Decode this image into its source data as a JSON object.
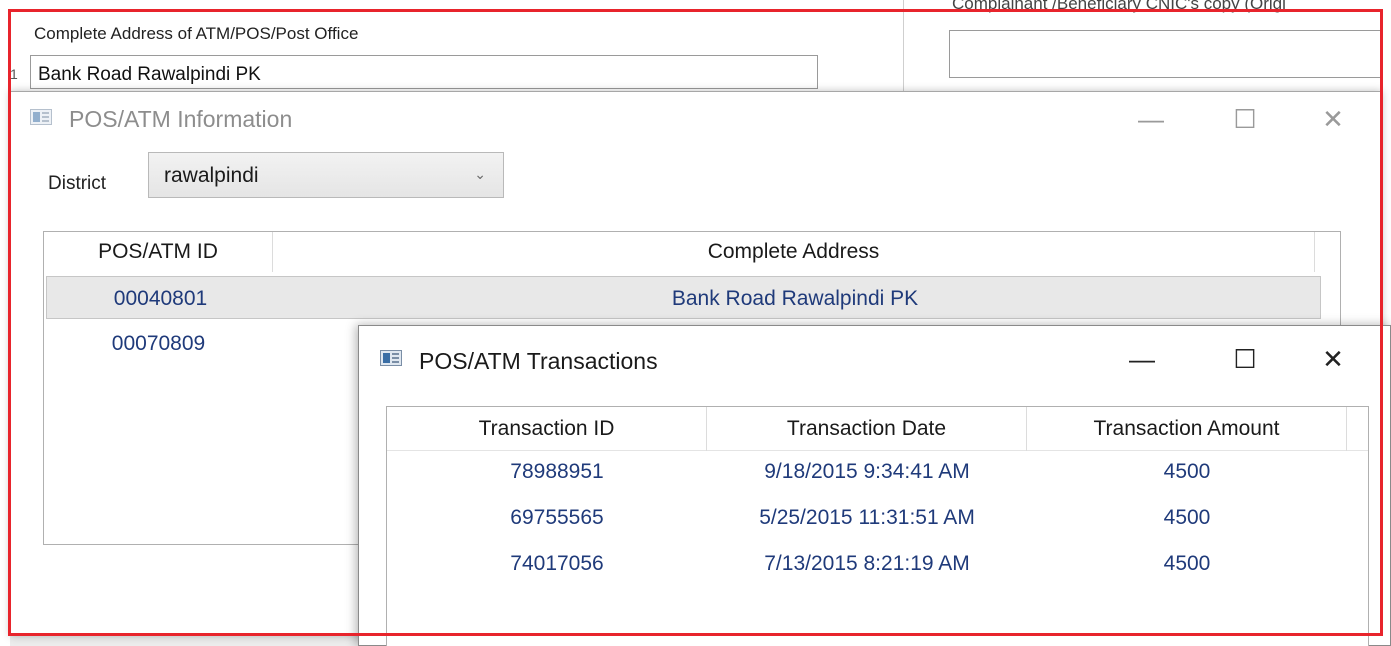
{
  "background_form": {
    "address_label": "Complete Address of ATM/POS/Post Office",
    "address_value": "Bank Road Rawalpindi PK",
    "cnic_label": "Complainant /Beneficiary CNIC's copy (Origi",
    "stray_char": "1"
  },
  "info_window": {
    "title": "POS/ATM Information",
    "controls": {
      "minimize": "—",
      "maximize": "☐",
      "close": "✕"
    },
    "district": {
      "label": "District",
      "value": "rawalpindi"
    },
    "grid": {
      "columns": [
        "POS/ATM ID",
        "Complete Address"
      ],
      "rows": [
        {
          "id": "00040801",
          "address": "Bank Road Rawalpindi PK",
          "selected": true
        },
        {
          "id": "00070809",
          "address": "",
          "selected": false
        }
      ]
    }
  },
  "transactions_window": {
    "title": "POS/ATM Transactions",
    "controls": {
      "minimize": "—",
      "maximize": "☐",
      "close": "✕"
    },
    "grid": {
      "columns": [
        "Transaction ID",
        "Transaction Date",
        "Transaction Amount"
      ],
      "rows": [
        {
          "id": "78988951",
          "date": "9/18/2015 9:34:41 AM",
          "amount": "4500"
        },
        {
          "id": "69755565",
          "date": "5/25/2015 11:31:51 AM",
          "amount": "4500"
        },
        {
          "id": "74017056",
          "date": "7/13/2015 8:21:19 AM",
          "amount": "4500"
        }
      ]
    }
  },
  "colors": {
    "highlight": "#e8242c",
    "cell_text": "#1f3a7a"
  },
  "icons": [
    "app-window-icon",
    "chevron-down-icon",
    "minimize-icon",
    "maximize-icon",
    "close-icon"
  ]
}
